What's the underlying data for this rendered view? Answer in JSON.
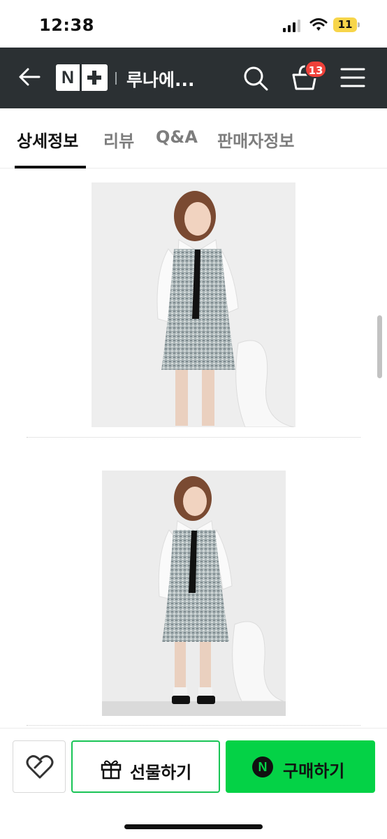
{
  "status_bar": {
    "time": "12:38",
    "battery_level": "11",
    "icons": [
      "signal-icon",
      "wifi-icon",
      "battery-icon"
    ]
  },
  "header": {
    "logo_text": "N",
    "title": "루나에...",
    "cart_count": "13",
    "icons": [
      "back-arrow-icon",
      "search-icon",
      "cart-icon",
      "menu-icon"
    ]
  },
  "tabs": [
    {
      "label": "상세정보",
      "active": true
    },
    {
      "label": "리뷰",
      "active": false
    },
    {
      "label": "Q&A",
      "active": false
    },
    {
      "label": "판매자정보",
      "active": false
    }
  ],
  "content": {
    "images": [
      "product-photo-1",
      "product-photo-2"
    ]
  },
  "bottom_bar": {
    "gift_label": "선물하기",
    "buy_label": "구매하기",
    "buy_icon_text": "N",
    "icons": [
      "heart-icon",
      "gift-icon",
      "naver-pay-icon"
    ]
  },
  "colors": {
    "header_bg": "#2b3033",
    "badge": "#f0413a",
    "accent_green": "#04d246",
    "gift_border": "#19c456"
  }
}
